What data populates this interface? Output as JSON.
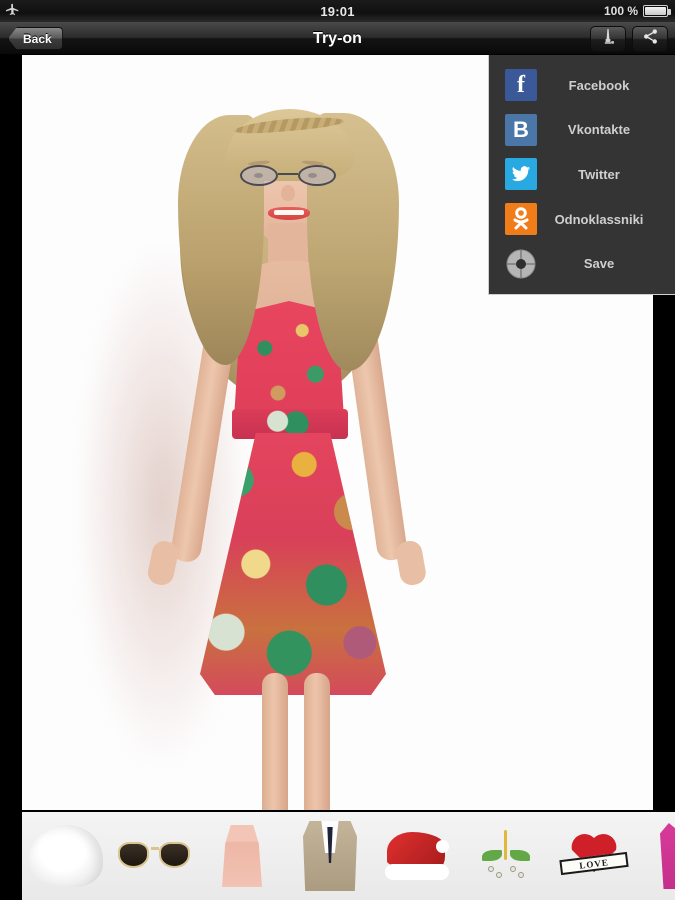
{
  "statusbar": {
    "airplane_icon": "airplane-icon",
    "time": "19:01",
    "battery_percent": "100 %",
    "battery_icon": "battery-full-icon"
  },
  "navbar": {
    "back_label": "Back",
    "title": "Try-on",
    "buttons": [
      {
        "name": "landmark-button",
        "icon": "monument-icon"
      },
      {
        "name": "share-button",
        "icon": "share-icon"
      }
    ]
  },
  "share_panel": {
    "visible": true,
    "background": "#343434",
    "items": [
      {
        "label": "Facebook",
        "icon": "facebook-icon",
        "glyph": "f",
        "color": "#3b5998"
      },
      {
        "label": "Vkontakte",
        "icon": "vkontakte-icon",
        "glyph": "B",
        "color": "#4a76a8"
      },
      {
        "label": "Twitter",
        "icon": "twitter-icon",
        "glyph": "",
        "color": "#29a9e1"
      },
      {
        "label": "Odnoklassniki",
        "icon": "odnoklassniki-icon",
        "glyph": "OK",
        "color": "#f07d1a"
      },
      {
        "label": "Save",
        "icon": "save-disc-icon",
        "glyph": "",
        "color": "#9a9a9a"
      }
    ]
  },
  "canvas": {
    "name": "try-on-photo",
    "description": "Model wearing blonde curly wig, glasses and floral dress",
    "background": "#fdfdfd"
  },
  "thumbnails": [
    {
      "name": "thumbnail-wig",
      "label": "White wig"
    },
    {
      "name": "thumbnail-sunglasses",
      "label": "Aviator sunglasses"
    },
    {
      "name": "thumbnail-dress",
      "label": "Pink dress"
    },
    {
      "name": "thumbnail-suit",
      "label": "Beige suit"
    },
    {
      "name": "thumbnail-santa-hat",
      "label": "Santa hat"
    },
    {
      "name": "thumbnail-mistletoe",
      "label": "Mistletoe"
    },
    {
      "name": "thumbnail-heart-tattoo",
      "label": "Love heart tattoo",
      "banner_text": "LOVE"
    },
    {
      "name": "thumbnail-tank-top",
      "label": "Pink tank top"
    }
  ]
}
